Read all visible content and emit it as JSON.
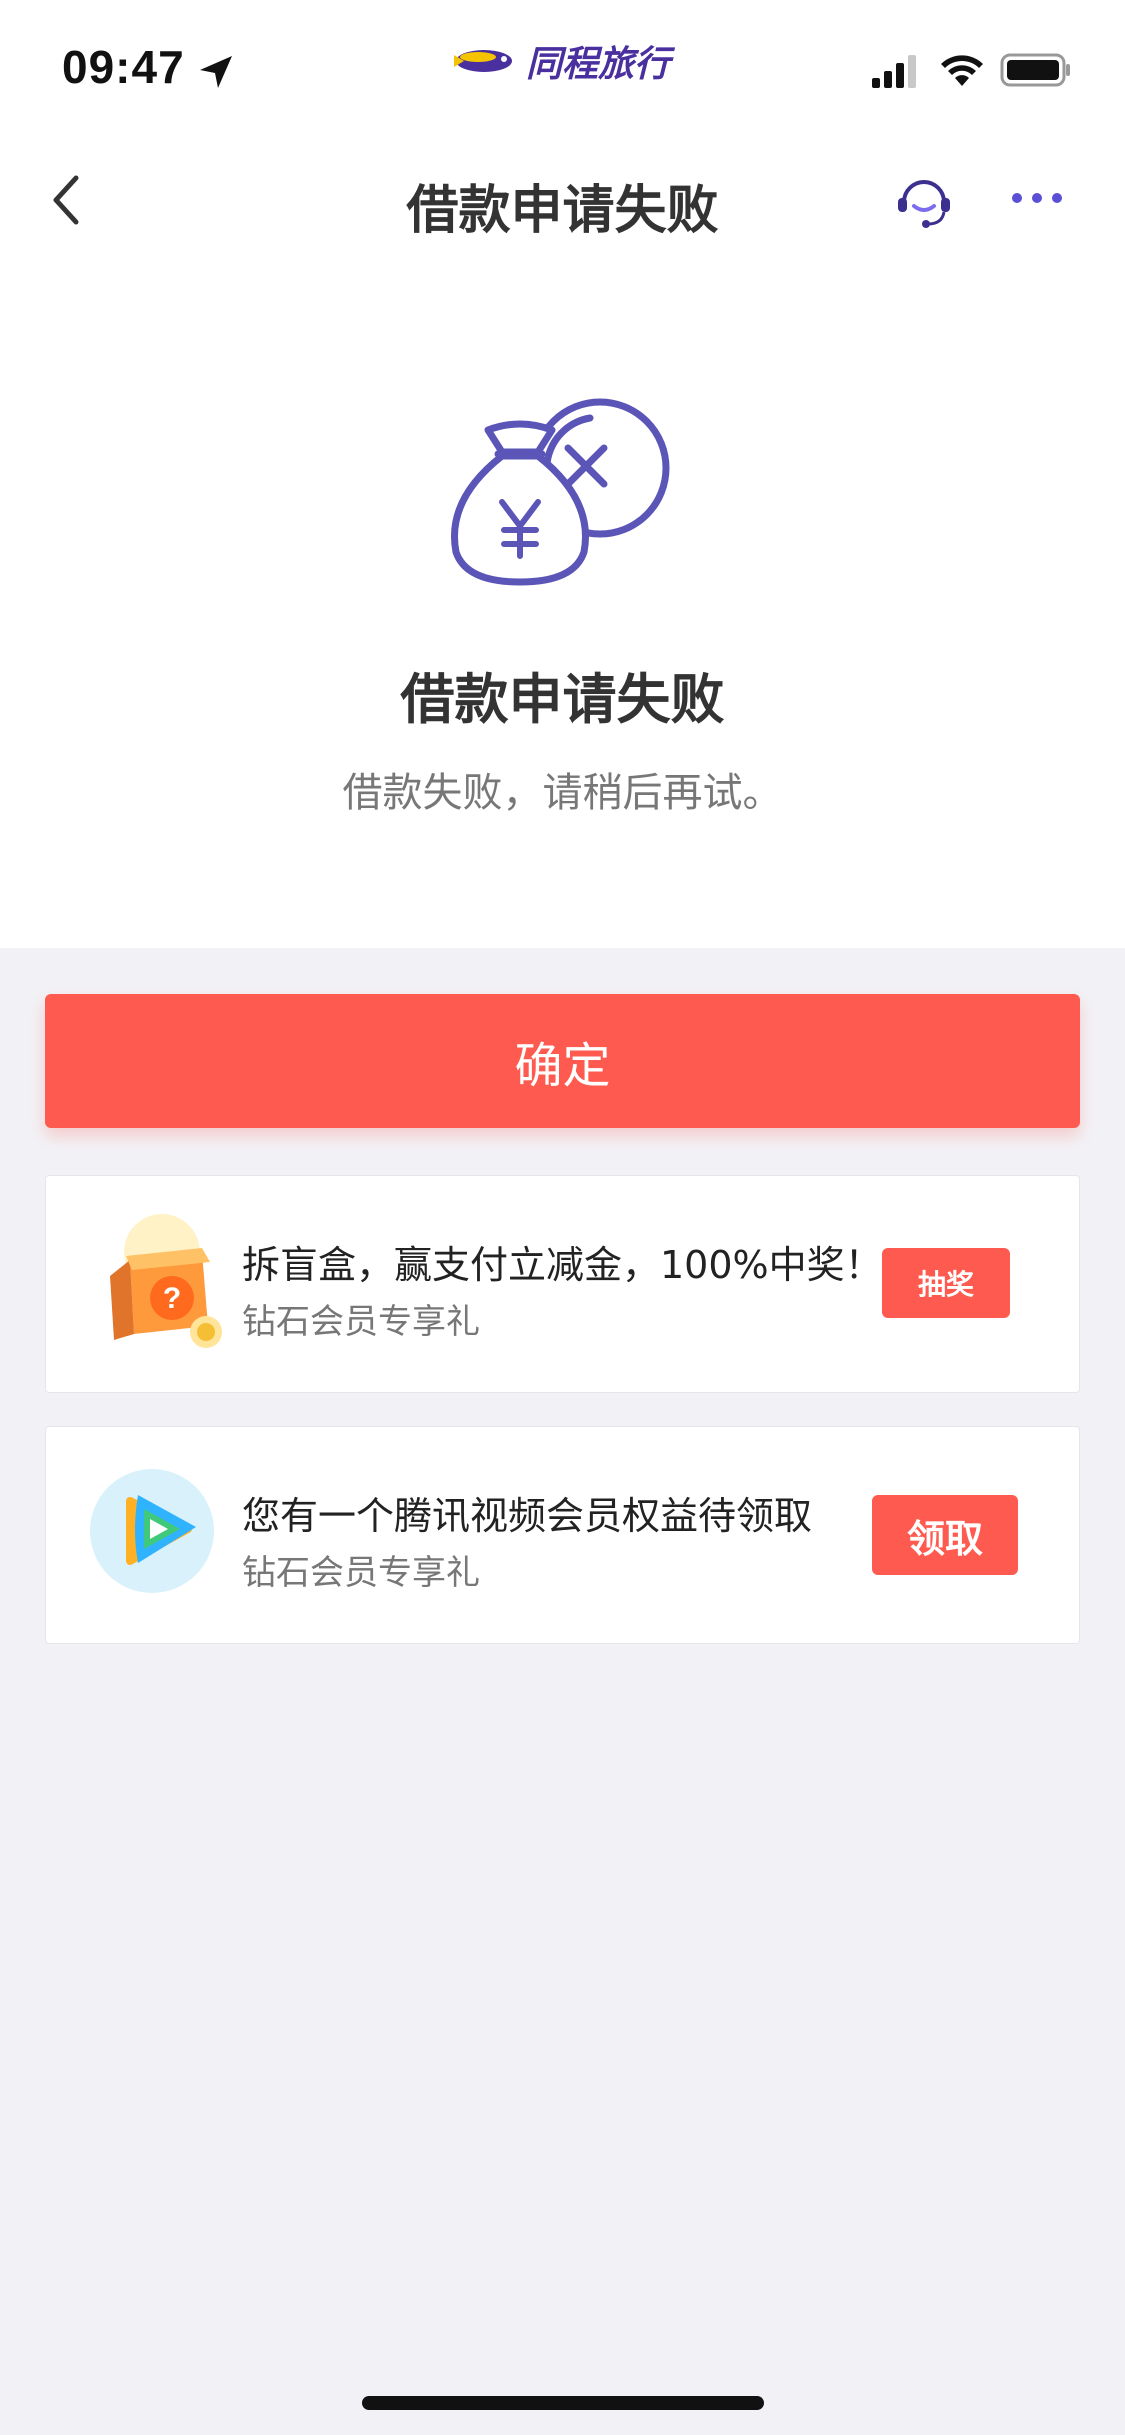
{
  "status_bar": {
    "time": "09:47",
    "brand_name": "同程旅行"
  },
  "nav": {
    "title": "借款申请失败"
  },
  "result": {
    "title": "借款申请失败",
    "message": "借款失败，请稍后再试。",
    "icon": "money-bag-failed-icon"
  },
  "actions": {
    "confirm_label": "确定"
  },
  "promos": [
    {
      "title": "拆盲盒，赢支付立减金，100%中奖！",
      "subtitle": "钻石会员专享礼",
      "button_label": "抽奖",
      "icon": "blind-box-icon"
    },
    {
      "title": "您有一个腾讯视频会员权益待领取",
      "subtitle": "钻石会员专享礼",
      "button_label": "领取",
      "icon": "tencent-video-icon"
    }
  ],
  "colors": {
    "accent": "#ff5a4f",
    "icon_purple": "#5b55b8",
    "brand_purple": "#4a2f9e",
    "page_bg": "#f2f2f6"
  }
}
